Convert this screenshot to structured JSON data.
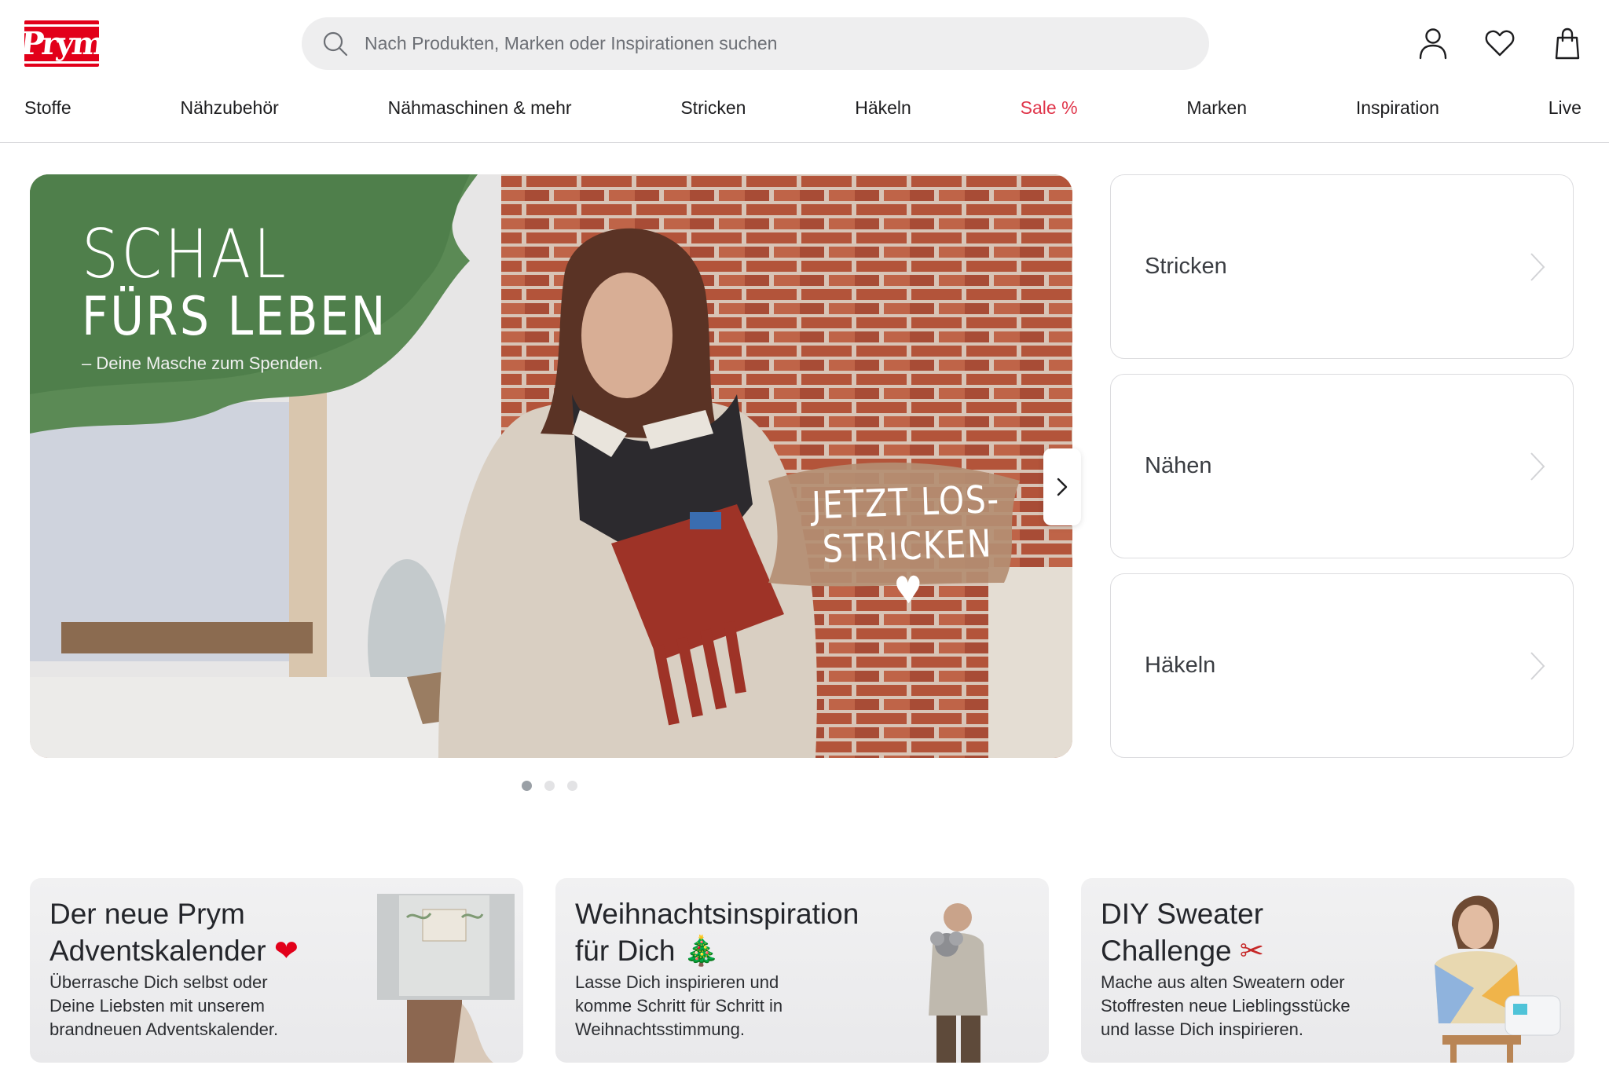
{
  "header": {
    "logo_text": "Prym",
    "search_placeholder": "Nach Produkten, Marken oder Inspirationen suchen",
    "icons": [
      "account-icon",
      "heart-icon",
      "shopping-bag-icon"
    ]
  },
  "nav": {
    "items": [
      "Stoffe",
      "Nähzubehör",
      "Nähmaschinen & mehr",
      "Stricken",
      "Häkeln",
      "Sale %",
      "Marken",
      "Inspiration",
      "Live"
    ]
  },
  "hero": {
    "title_line1": "SCHAL",
    "title_line2": "FÜRS LEBEN",
    "subtitle": "– Deine Masche zum Spenden.",
    "cta_line1": "JETZT LOS-",
    "cta_line2": "STRICKEN ♥",
    "slide_count": 3,
    "active_slide": 1
  },
  "categories": [
    "Stricken",
    "Nähen",
    "Häkeln"
  ],
  "promos": [
    {
      "title_line1": "Der neue Prym",
      "title_line2": "Adventskalender",
      "title_emoji": "❤",
      "desc_line1": "Überrasche Dich selbst oder",
      "desc_line2": "Deine Liebsten mit unserem",
      "desc_line3": "brandneuen Adventskalender."
    },
    {
      "title_line1": "Weihnachtsinspiration",
      "title_line2": "für Dich",
      "title_emoji": "🎄",
      "desc_line1": "Lasse Dich inspirieren und",
      "desc_line2": "komme Schritt für Schritt in",
      "desc_line3": "Weihnachtsstimmung."
    },
    {
      "title_line1": "DIY Sweater",
      "title_line2": "Challenge",
      "title_emoji": "✂",
      "desc_line1": "Mache aus alten Sweatern oder",
      "desc_line2": "Stoffresten neue Lieblingsstücke",
      "desc_line3": "und lasse Dich inspirieren."
    }
  ],
  "colors": {
    "brand_red": "#e2001a",
    "sale_red": "#e0364b",
    "text": "#1d1d1f"
  }
}
